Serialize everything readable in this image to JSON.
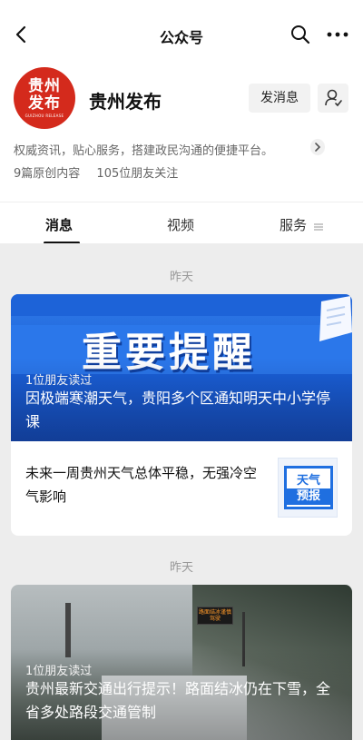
{
  "nav": {
    "title": "公众号"
  },
  "profile": {
    "logo_line1": "贵州",
    "logo_line2": "发布",
    "logo_sub": "GUIZHOU RELEASE",
    "name": "贵州发布",
    "message_button": "发消息",
    "description": "权威资讯，贴心服务，搭建政民沟通的便捷平台。",
    "original_count": "9篇原创内容",
    "followers": "105位朋友关注"
  },
  "tabs": {
    "messages": "消息",
    "video": "视频",
    "services": "服务"
  },
  "feed": {
    "groups": [
      {
        "date": "昨天",
        "hero_banner": "重要提醒",
        "hero_read": "1位朋友读过",
        "hero_title": "因极端寒潮天气，贵阳多个区通知明天中小学停课",
        "sub_title": "未来一周贵州天气总体平稳，无强冷空气影响",
        "thumb_line1": "天气",
        "thumb_line2": "预报"
      },
      {
        "date": "昨天",
        "sign_text": "路面结冰谨慎驾驶",
        "hero_read": "1位朋友读过",
        "hero_title": "贵州最新交通出行提示！路面结冰仍在下雪，全省多处路段交通管制"
      }
    ]
  },
  "colors": {
    "logo_red": "#d42a1c",
    "banner_blue": "#1f6fe0"
  }
}
